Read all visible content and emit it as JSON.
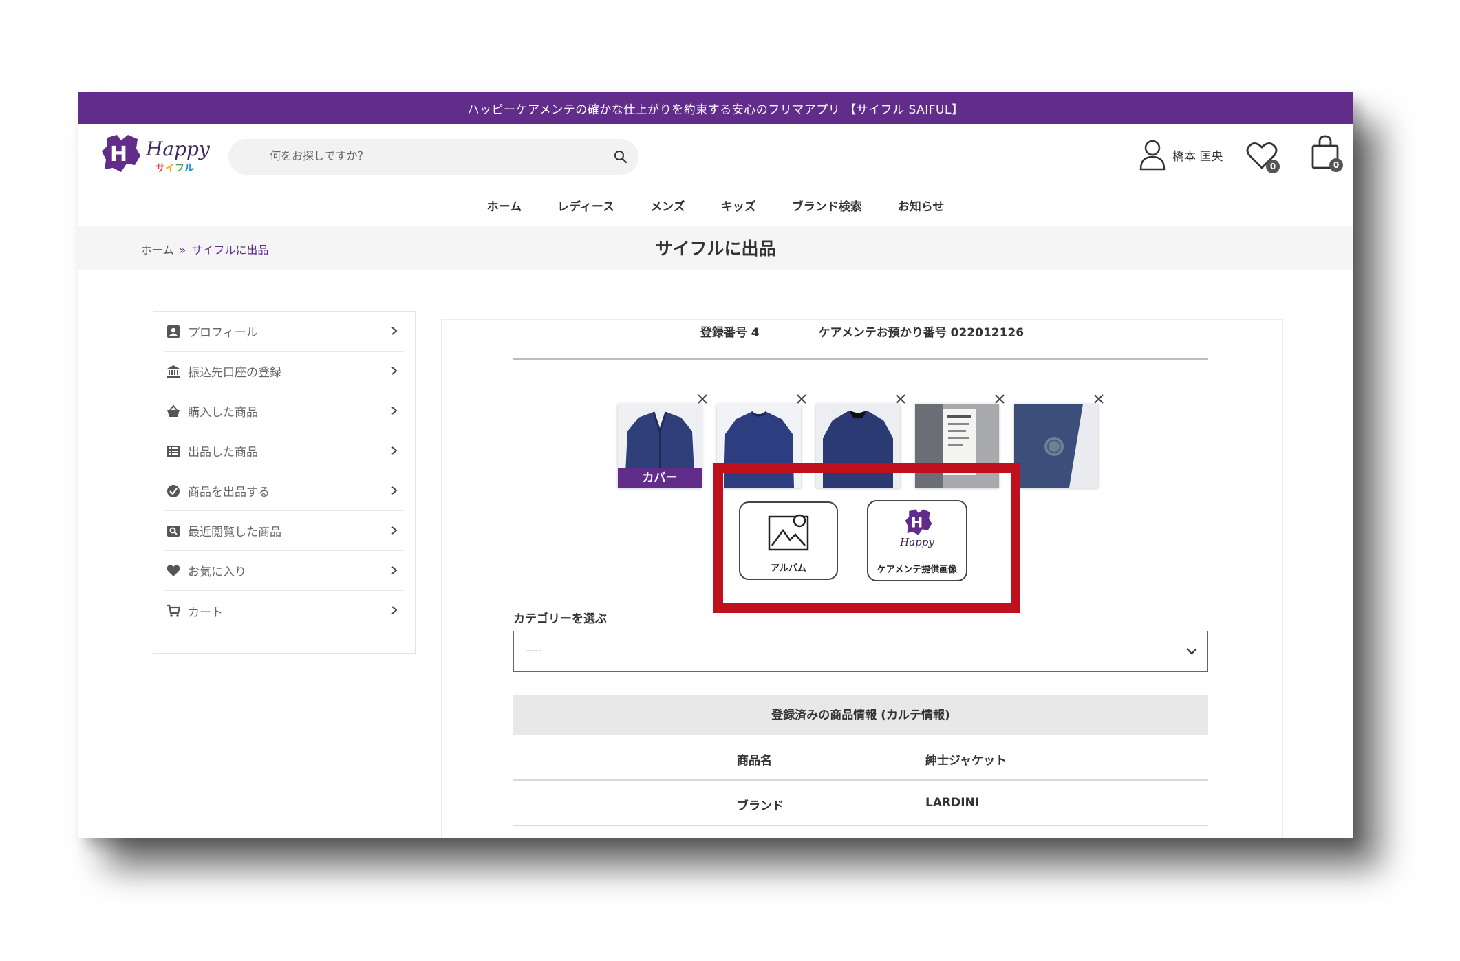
{
  "banner": {
    "text": "ハッピーケアメンテの確かな仕上がりを約束する安心のフリマアプリ 【サイフル SAIFUL】"
  },
  "header": {
    "logo_text": "Happy",
    "logo_sub": [
      "サ",
      "イ",
      "フ",
      "ル"
    ],
    "search_placeholder": "何をお探しですか？",
    "user_name": "橋本 匡央",
    "wishlist_count": "0",
    "cart_count": "0"
  },
  "nav": {
    "items": [
      "ホーム",
      "レディース",
      "メンズ",
      "キッズ",
      "ブランド検索",
      "お知らせ"
    ]
  },
  "breadcrumb": {
    "home": "ホーム",
    "sep": "»",
    "current": "サイフルに出品"
  },
  "page_title": "サイフルに出品",
  "sidebar": {
    "items": [
      {
        "label": "プロフィール",
        "icon": "profile-icon"
      },
      {
        "label": "振込先口座の登録",
        "icon": "bank-icon"
      },
      {
        "label": "購入した商品",
        "icon": "basket-icon"
      },
      {
        "label": "出品した商品",
        "icon": "list-icon"
      },
      {
        "label": "商品を出品する",
        "icon": "check-circle-icon"
      },
      {
        "label": "最近閲覧した商品",
        "icon": "recent-view-icon"
      },
      {
        "label": "お気に入り",
        "icon": "heart-icon"
      },
      {
        "label": "カート",
        "icon": "cart-icon"
      }
    ]
  },
  "registration": {
    "number_text": "登録番号 4",
    "care_number_text": "ケアメンテお預かり番号 022012126"
  },
  "images": {
    "cover_label": "カバー",
    "thumbnails": [
      "jacket-front",
      "jacket-back",
      "jacket-lining",
      "label-tag",
      "button-detail"
    ]
  },
  "upload_options": {
    "album_label": "アルバム",
    "provided_label": "ケアメンテ提供画像",
    "provided_logo_text": "Happy"
  },
  "category": {
    "label": "カテゴリーを選ぶ",
    "value": "----"
  },
  "product_info": {
    "heading": "登録済みの商品情報 (カルテ情報)",
    "rows": [
      {
        "key": "商品名",
        "value": "紳士ジャケット"
      },
      {
        "key": "ブランド",
        "value": "LARDINI"
      }
    ]
  },
  "colors": {
    "brand_purple": "#622c8a",
    "highlight_red": "#c0101e"
  }
}
